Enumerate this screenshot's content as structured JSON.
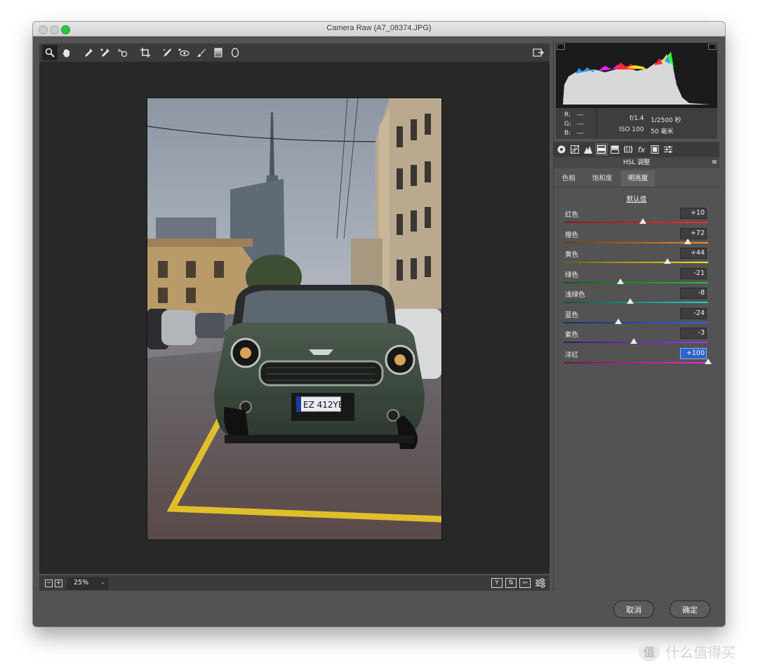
{
  "window": {
    "title": "Camera Raw (A7_08374.JPG)"
  },
  "toolbar": {
    "tools": [
      "zoom-tool-icon",
      "hand-tool-icon",
      "white-balance-tool-icon",
      "color-sampler-tool-icon",
      "targeted-adjustment-tool-icon",
      "crop-tool-icon",
      "spot-removal-tool-icon",
      "red-eye-tool-icon",
      "adjustment-brush-icon",
      "graduated-filter-icon",
      "radial-filter-icon"
    ],
    "export_icon": "open-preferences-icon"
  },
  "preview": {
    "zoom": "25%",
    "license_plate": "EZ 412YB"
  },
  "info": {
    "r_label": "R:",
    "r_value": "---",
    "g_label": "G:",
    "g_value": "---",
    "b_label": "B:",
    "b_value": "---",
    "aperture": "f/1.4",
    "shutter": "1/2500 秒",
    "iso": "ISO 100",
    "focal": "50 毫米"
  },
  "panel": {
    "title": "HSL 调整",
    "subtabs": [
      "色相",
      "饱和度",
      "明亮度"
    ],
    "active_subtab": "明亮度",
    "defaults_link": "默认值",
    "sliders": [
      {
        "label": "红色",
        "value": "+10",
        "pct": 0.55,
        "colors": [
          "#7a1f1f",
          "#ff2a2a"
        ]
      },
      {
        "label": "橙色",
        "value": "+72",
        "pct": 0.86,
        "colors": [
          "#6a3a10",
          "#ff8a1e"
        ]
      },
      {
        "label": "黄色",
        "value": "+44",
        "pct": 0.72,
        "colors": [
          "#6a6010",
          "#ffe21e"
        ]
      },
      {
        "label": "绿色",
        "value": "-21",
        "pct": 0.395,
        "colors": [
          "#17551a",
          "#29c23a"
        ]
      },
      {
        "label": "浅绿色",
        "value": "-8",
        "pct": 0.46,
        "colors": [
          "#14504a",
          "#22d3c2"
        ]
      },
      {
        "label": "蓝色",
        "value": "-24",
        "pct": 0.38,
        "colors": [
          "#142d6a",
          "#2a63ff"
        ]
      },
      {
        "label": "紫色",
        "value": "-3",
        "pct": 0.485,
        "colors": [
          "#3c166a",
          "#9a3aff"
        ]
      },
      {
        "label": "洋红",
        "value": "+100",
        "pct": 1.0,
        "colors": [
          "#6a1450",
          "#ff2ad0"
        ],
        "selected": true
      }
    ]
  },
  "buttons": {
    "cancel": "取消",
    "ok": "确定"
  },
  "watermark": {
    "logo": "值",
    "text": "什么值得买"
  },
  "colors": {
    "window_bg": "#535353",
    "preview_bg": "#282828",
    "accent": "#2c64c8"
  }
}
